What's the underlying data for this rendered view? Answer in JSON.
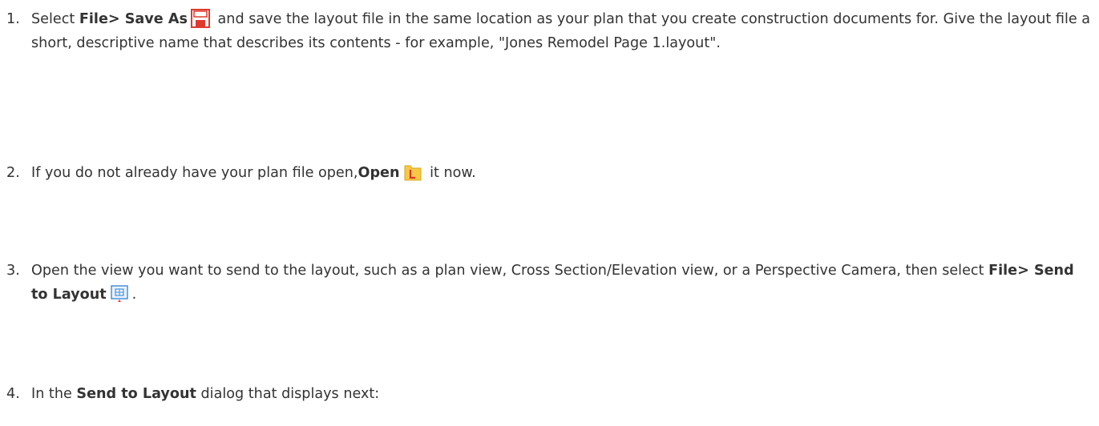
{
  "steps": [
    {
      "num": "1.",
      "pre": "Select ",
      "bold": "File> Save As",
      "icon": "save-as-icon",
      "post": " and save the layout file in the same location as your plan that you create construction documents for. Give the layout file a short, descriptive name that describes its contents - for example, \"Jones Remodel Page 1.layout\"."
    },
    {
      "num": "2.",
      "pre": "If you do not already have your plan file open,",
      "bold": "Open",
      "icon": "open-file-icon",
      "post": " it now."
    },
    {
      "num": "3.",
      "pre": "Open the view you want to send to the layout, such as a plan view, Cross Section/Elevation view, or a Perspective Camera, then select ",
      "bold": "File> Send to Layout",
      "icon": "send-to-layout-icon",
      "post": "."
    },
    {
      "num": "4.",
      "pre": "In the ",
      "bold": "Send to Layout",
      "post": " dialog that displays next:"
    }
  ],
  "colors": {
    "text": "#333333",
    "save_red": "#e03a2f",
    "open_yellow": "#f7c843",
    "open_red": "#d9352a",
    "layout_blue": "#4a90d9"
  }
}
